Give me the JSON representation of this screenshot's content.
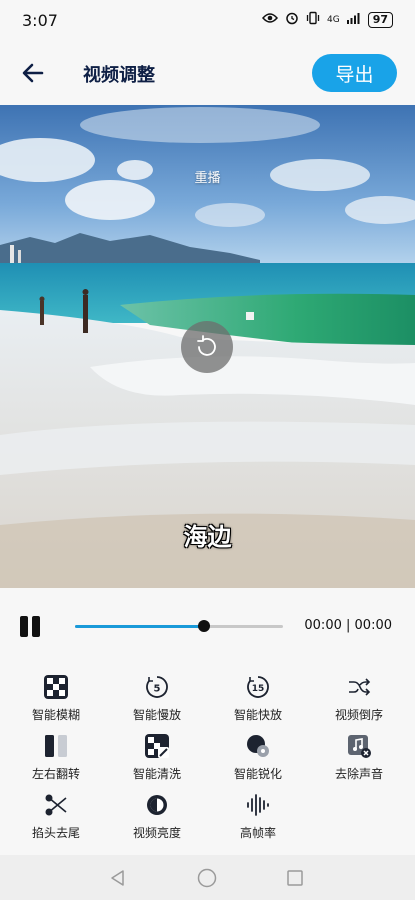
{
  "status_bar": {
    "time": "3:07",
    "network": "4G",
    "battery": "97"
  },
  "header": {
    "title": "视频调整",
    "export_label": "导出"
  },
  "video": {
    "replay_label": "重播",
    "caption": "海边"
  },
  "playback": {
    "current_time": "00:00",
    "separator": "|",
    "total_time": "00:00",
    "progress": 0.62
  },
  "tools": [
    {
      "label": "智能模糊",
      "icon": "blur-icon"
    },
    {
      "label": "智能慢放",
      "icon": "slow-motion-icon"
    },
    {
      "label": "智能快放",
      "icon": "fast-forward-icon"
    },
    {
      "label": "视频倒序",
      "icon": "reverse-icon"
    },
    {
      "label": "左右翻转",
      "icon": "flip-icon"
    },
    {
      "label": "智能清洗",
      "icon": "clean-icon"
    },
    {
      "label": "智能锐化",
      "icon": "sharpen-icon"
    },
    {
      "label": "去除声音",
      "icon": "mute-audio-icon"
    },
    {
      "label": "掐头去尾",
      "icon": "trim-icon"
    },
    {
      "label": "视频亮度",
      "icon": "brightness-icon"
    },
    {
      "label": "高帧率",
      "icon": "high-framerate-icon"
    }
  ],
  "icon_badges": {
    "slow": "5",
    "fast": "15"
  },
  "colors": {
    "accent": "#19a3e8",
    "title": "#0e1f45",
    "seek_fill": "#1a9ad9"
  }
}
